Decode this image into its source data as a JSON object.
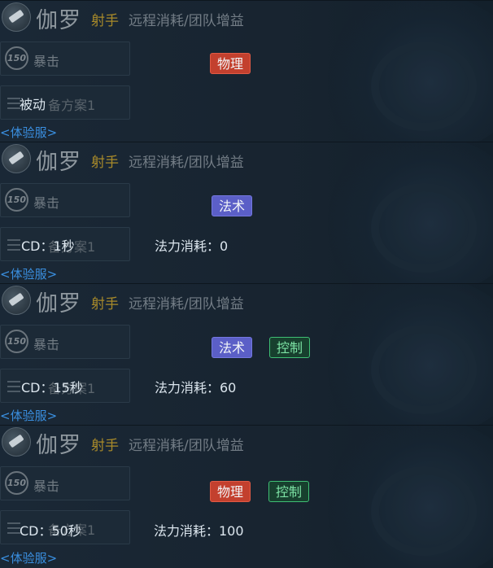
{
  "hero": {
    "name": "伽罗",
    "role": "射手",
    "desc": "远程消耗/团队增益",
    "skill_name": "暴击",
    "level_badge": "150",
    "plan_label": "备方案1",
    "server_link": "<体验服>"
  },
  "panels": [
    {
      "overlay": "被动",
      "mana": "",
      "tags": [
        {
          "label": "物理",
          "kind": "physical"
        }
      ]
    },
    {
      "overlay": "CD：1秒",
      "mana": "法力消耗：0",
      "tags": [
        {
          "label": "法术",
          "kind": "magic"
        }
      ]
    },
    {
      "overlay": "CD：15秒",
      "mana": "法力消耗：60",
      "tags": [
        {
          "label": "法术",
          "kind": "magic"
        },
        {
          "label": "控制",
          "kind": "control"
        }
      ]
    },
    {
      "overlay": "CD：50秒",
      "mana": "法力消耗：100",
      "tags": [
        {
          "label": "物理",
          "kind": "physical"
        },
        {
          "label": "控制",
          "kind": "control"
        }
      ]
    }
  ],
  "colors": {
    "physical": "#c3402e",
    "magic": "#5b5fc7",
    "control": "#3fbf74",
    "role": "#a88a2a",
    "link": "#3a8fe0"
  }
}
